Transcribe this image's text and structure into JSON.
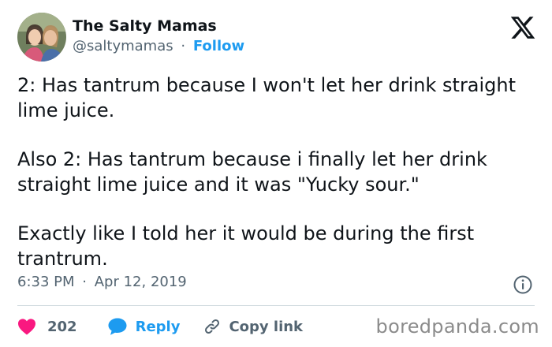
{
  "author": {
    "name": "The Salty Mamas",
    "handle": "@saltymamas",
    "separator": "·",
    "follow_label": "Follow"
  },
  "tweet": {
    "paragraphs": [
      "2: Has tantrum because I won't let her drink straight lime juice.",
      "Also 2: Has tantrum because i finally let her drink straight lime juice and it was \"Yucky sour.\"",
      "Exactly like I told her it would be during the first trantrum."
    ],
    "time": "6:33 PM",
    "separator": "·",
    "date": "Apr 12, 2019"
  },
  "actions": {
    "like_count": "202",
    "reply_label": "Reply",
    "copy_label": "Copy link"
  },
  "icons": {
    "platform": "x-logo-icon",
    "info": "info-icon",
    "like": "heart-icon",
    "reply": "speech-bubble-icon",
    "copy": "link-icon"
  },
  "colors": {
    "accent": "#1d9bf0",
    "like": "#f91880",
    "muted": "#536471",
    "text": "#0f1419"
  },
  "watermark": "boredpanda.com"
}
